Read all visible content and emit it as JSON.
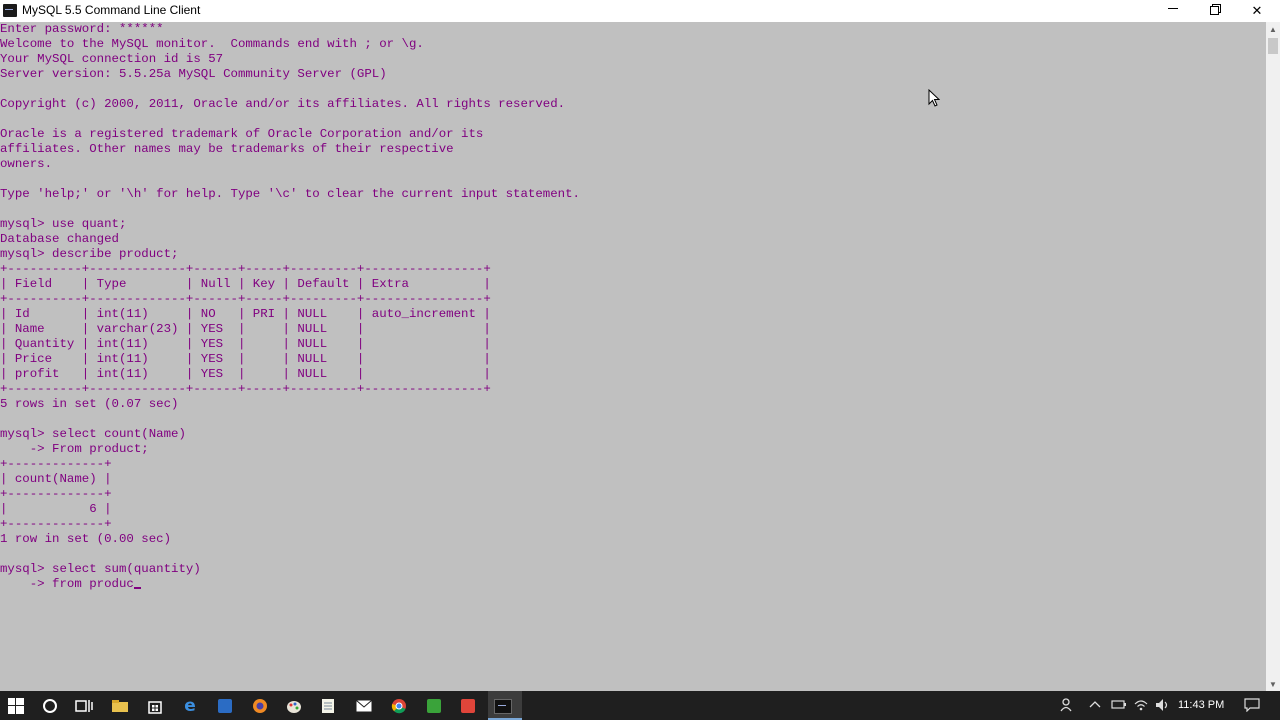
{
  "window": {
    "title": "MySQL 5.5 Command Line Client"
  },
  "console": {
    "lines": [
      "Enter password: ******",
      "Welcome to the MySQL monitor.  Commands end with ; or \\g.",
      "Your MySQL connection id is 57",
      "Server version: 5.5.25a MySQL Community Server (GPL)",
      "",
      "Copyright (c) 2000, 2011, Oracle and/or its affiliates. All rights reserved.",
      "",
      "Oracle is a registered trademark of Oracle Corporation and/or its",
      "affiliates. Other names may be trademarks of their respective",
      "owners.",
      "",
      "Type 'help;' or '\\h' for help. Type '\\c' to clear the current input statement.",
      "",
      "mysql> use quant;",
      "Database changed",
      "mysql> describe product;",
      "+----------+-------------+------+-----+---------+----------------+",
      "| Field    | Type        | Null | Key | Default | Extra          |",
      "+----------+-------------+------+-----+---------+----------------+",
      "| Id       | int(11)     | NO   | PRI | NULL    | auto_increment |",
      "| Name     | varchar(23) | YES  |     | NULL    |                |",
      "| Quantity | int(11)     | YES  |     | NULL    |                |",
      "| Price    | int(11)     | YES  |     | NULL    |                |",
      "| profit   | int(11)     | YES  |     | NULL    |                |",
      "+----------+-------------+------+-----+---------+----------------+",
      "5 rows in set (0.07 sec)",
      "",
      "mysql> select count(Name)",
      "    -> From product;",
      "+-------------+",
      "| count(Name) |",
      "+-------------+",
      "|           6 |",
      "+-------------+",
      "1 row in set (0.00 sec)",
      "",
      "mysql> select sum(quantity)",
      "    -> from produc"
    ]
  },
  "colors": {
    "console_background": "#c0c0c0",
    "console_text": "#800080",
    "taskbar": "#1f1f1f"
  },
  "taskbar": {
    "clock": "11:43 PM",
    "pinned_icons": [
      "windows-start-icon",
      "cortana-search-icon",
      "task-view-icon",
      "file-explorer-icon",
      "store-icon",
      "edge-icon",
      "word-icon",
      "firefox-icon",
      "paint-icon",
      "notepad-icon",
      "mail-icon",
      "chrome-icon",
      "camtasia-icon",
      "recorder-icon",
      "mysql-icon"
    ],
    "tray_icons": [
      "people-icon",
      "chevron-up-icon",
      "battery-icon",
      "network-icon",
      "volume-icon",
      "notification-icon"
    ]
  }
}
